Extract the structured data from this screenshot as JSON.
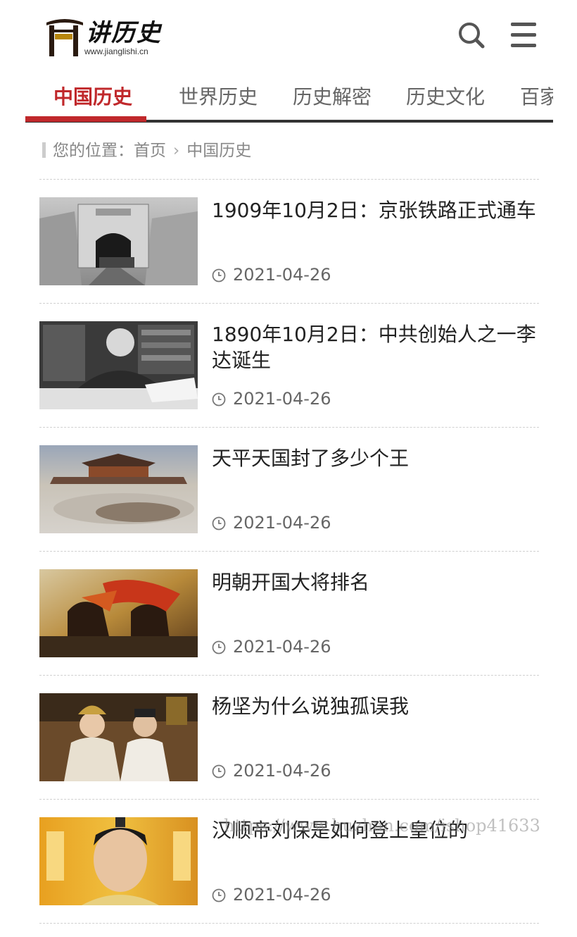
{
  "header": {
    "logo_text": "讲历史",
    "logo_url": "www.jianglishi.cn",
    "search_icon": "search-icon",
    "menu_icon": "hamburger-menu-icon"
  },
  "nav": {
    "items": [
      {
        "label": "中国历史",
        "active": true
      },
      {
        "label": "世界历史",
        "active": false
      },
      {
        "label": "历史解密",
        "active": false
      },
      {
        "label": "历史文化",
        "active": false
      },
      {
        "label": "百家",
        "active": false
      }
    ],
    "accent_color": "#c0282b"
  },
  "breadcrumb": {
    "prefix": "您的位置：",
    "home": "首页",
    "current": "中国历史"
  },
  "articles": [
    {
      "title": "1909年10月2日：京张铁路正式通车",
      "date": "2021-04-26",
      "thumb": "railway-tunnel-photo"
    },
    {
      "title": "1890年10月2日：中共创始人之一李达诞生",
      "date": "2021-04-26",
      "thumb": "man-writing-photo"
    },
    {
      "title": "天平天国封了多少个王",
      "date": "2021-04-26",
      "thumb": "palace-painting"
    },
    {
      "title": "明朝开国大将排名",
      "date": "2021-04-26",
      "thumb": "army-battle-painting"
    },
    {
      "title": "杨坚为什么说独孤误我",
      "date": "2021-04-26",
      "thumb": "drama-couple-still"
    },
    {
      "title": "汉顺帝刘保是如何登上皇位的",
      "date": "2021-04-26",
      "thumb": "drama-actor-still"
    }
  ],
  "watermark": "https://www.huzhan.com/ishop41633"
}
